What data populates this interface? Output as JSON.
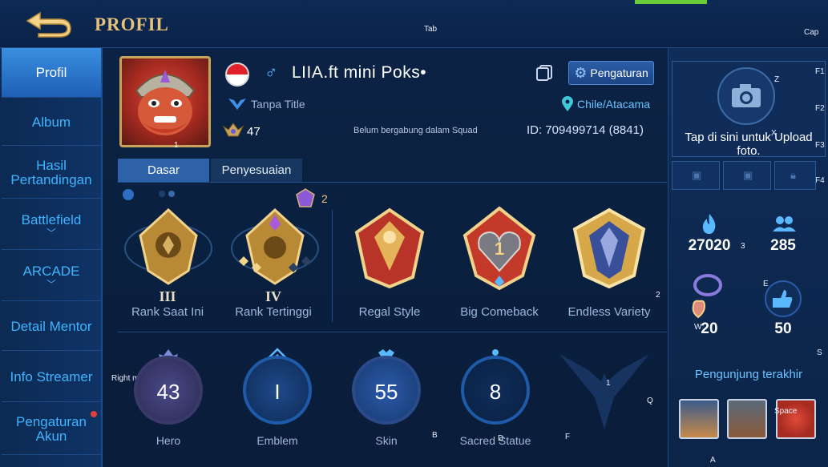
{
  "header": {
    "title": "PROFIL",
    "key_hints": {
      "tab": "Tab",
      "cap": "Cap",
      "f1": "F1",
      "f2": "F2",
      "f3": "F3",
      "f4": "F4",
      "z": "Z",
      "x": "X",
      "three": "3",
      "e": "E",
      "w": "W",
      "two": "2",
      "s": "S",
      "one": "1",
      "q": "Q",
      "f": "F",
      "b": "B",
      "d": "D",
      "a": "A",
      "space": "Space",
      "right_mouse": "Right mouse button"
    }
  },
  "sidebar": {
    "items": [
      {
        "label": "Profil",
        "active": true
      },
      {
        "label": "Album"
      },
      {
        "label": "Hasil Pertandingan"
      },
      {
        "label": "Battlefield",
        "chevron": true
      },
      {
        "label": "ARCADE",
        "chevron": true
      },
      {
        "label": "Detail Mentor"
      },
      {
        "label": "Info Streamer"
      },
      {
        "label": "Pengaturan Akun",
        "notification_dot": true
      }
    ]
  },
  "profile": {
    "name": "LIIA.ft mini Poks•",
    "title": "Tanpa Title",
    "level": "47",
    "squad": "Belum bergabung dalam Squad",
    "id": "ID: 709499714 (8841)",
    "location": "Chile/Atacama",
    "settings_label": "Pengaturan",
    "avatar_badge": "1"
  },
  "tabs": [
    {
      "label": "Dasar",
      "active": true
    },
    {
      "label": "Penyesuaian"
    }
  ],
  "badges": {
    "season_count": "2",
    "items": [
      {
        "label": "Rank Saat Ini",
        "roman": "III"
      },
      {
        "label": "Rank Tertinggi",
        "roman": "IV"
      },
      {
        "label": "Regal Style"
      },
      {
        "label": "Big Comeback"
      },
      {
        "label": "Endless Variety"
      }
    ]
  },
  "stats": [
    {
      "label": "Hero",
      "value": "43"
    },
    {
      "label": "Emblem",
      "value": "I"
    },
    {
      "label": "Skin",
      "value": "55"
    },
    {
      "label": "Sacred Statue",
      "value": "8"
    }
  ],
  "right_panel": {
    "upload_text": "Tap di sini untuk Upload foto.",
    "popularity": "27020",
    "followers": "285",
    "charm": "20",
    "likes": "50",
    "visitors_label": "Pengunjung terakhir"
  },
  "colors": {
    "accent": "#3fb4ff",
    "gold": "#e7c27a",
    "active_tab": "#2d62a8",
    "background": "#0b2346"
  }
}
